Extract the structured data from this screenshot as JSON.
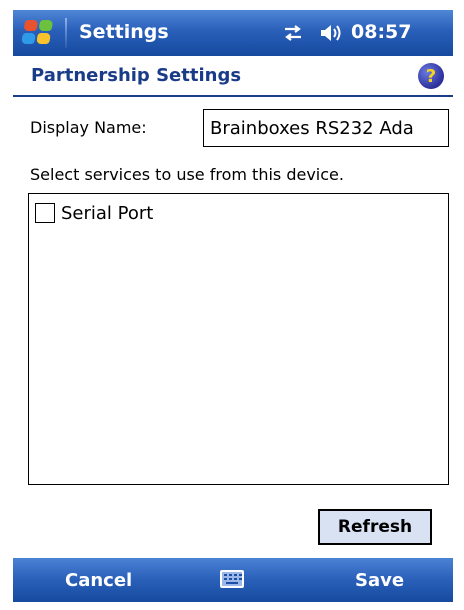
{
  "titlebar": {
    "app_title": "Settings",
    "clock": "08:57",
    "icons": [
      "windows-start-icon",
      "connectivity-icon",
      "volume-icon"
    ]
  },
  "header": {
    "title": "Partnership Settings",
    "help_icon": "help-icon",
    "help_glyph": "?"
  },
  "form": {
    "display_name_label": "Display Name:",
    "display_name_value": "Brainboxes RS232 Ada",
    "select_services_label": "Select services to use from this device.",
    "services": [
      {
        "label": "Serial Port",
        "checked": false
      }
    ],
    "refresh_label": "Refresh"
  },
  "softkeys": {
    "left": "Cancel",
    "right": "Save",
    "center_icon": "keyboard-icon"
  },
  "colors": {
    "bar_blue": "#2a5fb9",
    "title_text": "#1a3c88",
    "button_bg": "#d9e2f3"
  }
}
